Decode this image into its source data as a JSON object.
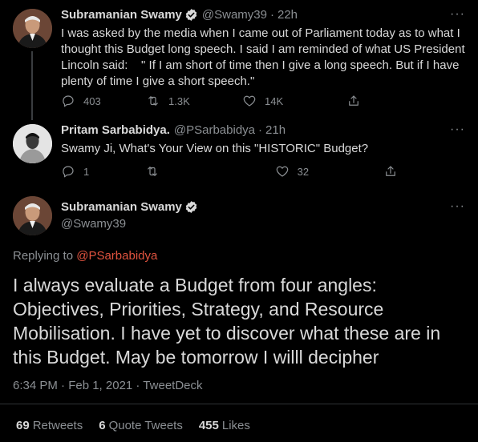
{
  "tweet1": {
    "name": "Subramanian Swamy",
    "handle": "@Swamy39",
    "sep": "·",
    "time": "22h",
    "text": "I was asked by the media when I came out of Parliament today as to what I thought this Budget long speech. I said I am reminded of what US President Lincoln said:    \" If I am short of time then I give a long speech. But if I have plenty of time I give a short speech.\"",
    "replies": "403",
    "retweets": "1.3K",
    "likes": "14K"
  },
  "tweet2": {
    "name": "Pritam Sarbabidya.",
    "handle": "@PSarbabidya",
    "sep": "·",
    "time": "21h",
    "text": "Swamy Ji, What's Your View on this \"HISTORIC\" Budget?",
    "replies": "1",
    "retweets": "",
    "likes": "32"
  },
  "main": {
    "name": "Subramanian Swamy",
    "handle": "@Swamy39",
    "replying_prefix": "Replying to",
    "replying_to": "@PSarbabidya",
    "text": "I always evaluate a Budget from four angles: Objectives, Priorities, Strategy, and Resource Mobilisation. I have yet to discover what these are in this Budget. May be tomorrow I willl decipher",
    "timestamp": "6:34 PM · Feb 1, 2021 · TweetDeck",
    "retweets_count": "69",
    "retweets_label": "Retweets",
    "quotes_count": "6",
    "quotes_label": "Quote Tweets",
    "likes_count": "455",
    "likes_label": "Likes"
  },
  "more_glyph": "···",
  "colors": {
    "background": "#000000",
    "text": "#d9d9d9",
    "muted": "#8b8f93",
    "verified": "#d9d9d9",
    "mention": "#e0533f"
  }
}
